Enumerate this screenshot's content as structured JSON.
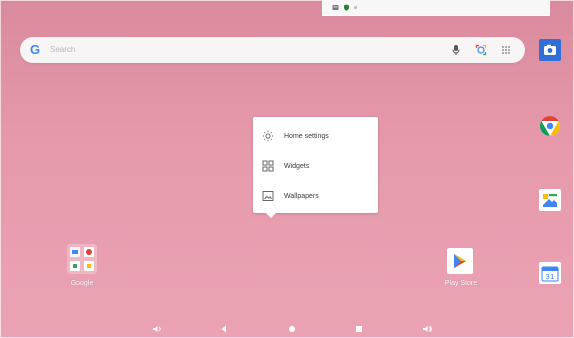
{
  "screen": {
    "background": "#e79aad"
  },
  "status_bar": {
    "items": [
      "sms-icon",
      "shield-icon",
      "dot"
    ]
  },
  "search": {
    "placeholder": "Search"
  },
  "menu": {
    "items": [
      {
        "label": "Home settings",
        "icon": "gear-icon"
      },
      {
        "label": "Widgets",
        "icon": "grid-icon"
      },
      {
        "label": "Wallpapers",
        "icon": "image-icon"
      }
    ]
  },
  "apps": {
    "google_folder": {
      "label": "Google"
    },
    "play_store": {
      "label": "Play Store"
    }
  },
  "dock": {
    "items": [
      "camera-icon",
      "chrome-icon",
      "photos-icon",
      "calendar-icon"
    ]
  },
  "nav": {
    "items": [
      "volume-left-icon",
      "back-icon",
      "home-icon",
      "recents-icon",
      "volume-right-icon"
    ]
  }
}
